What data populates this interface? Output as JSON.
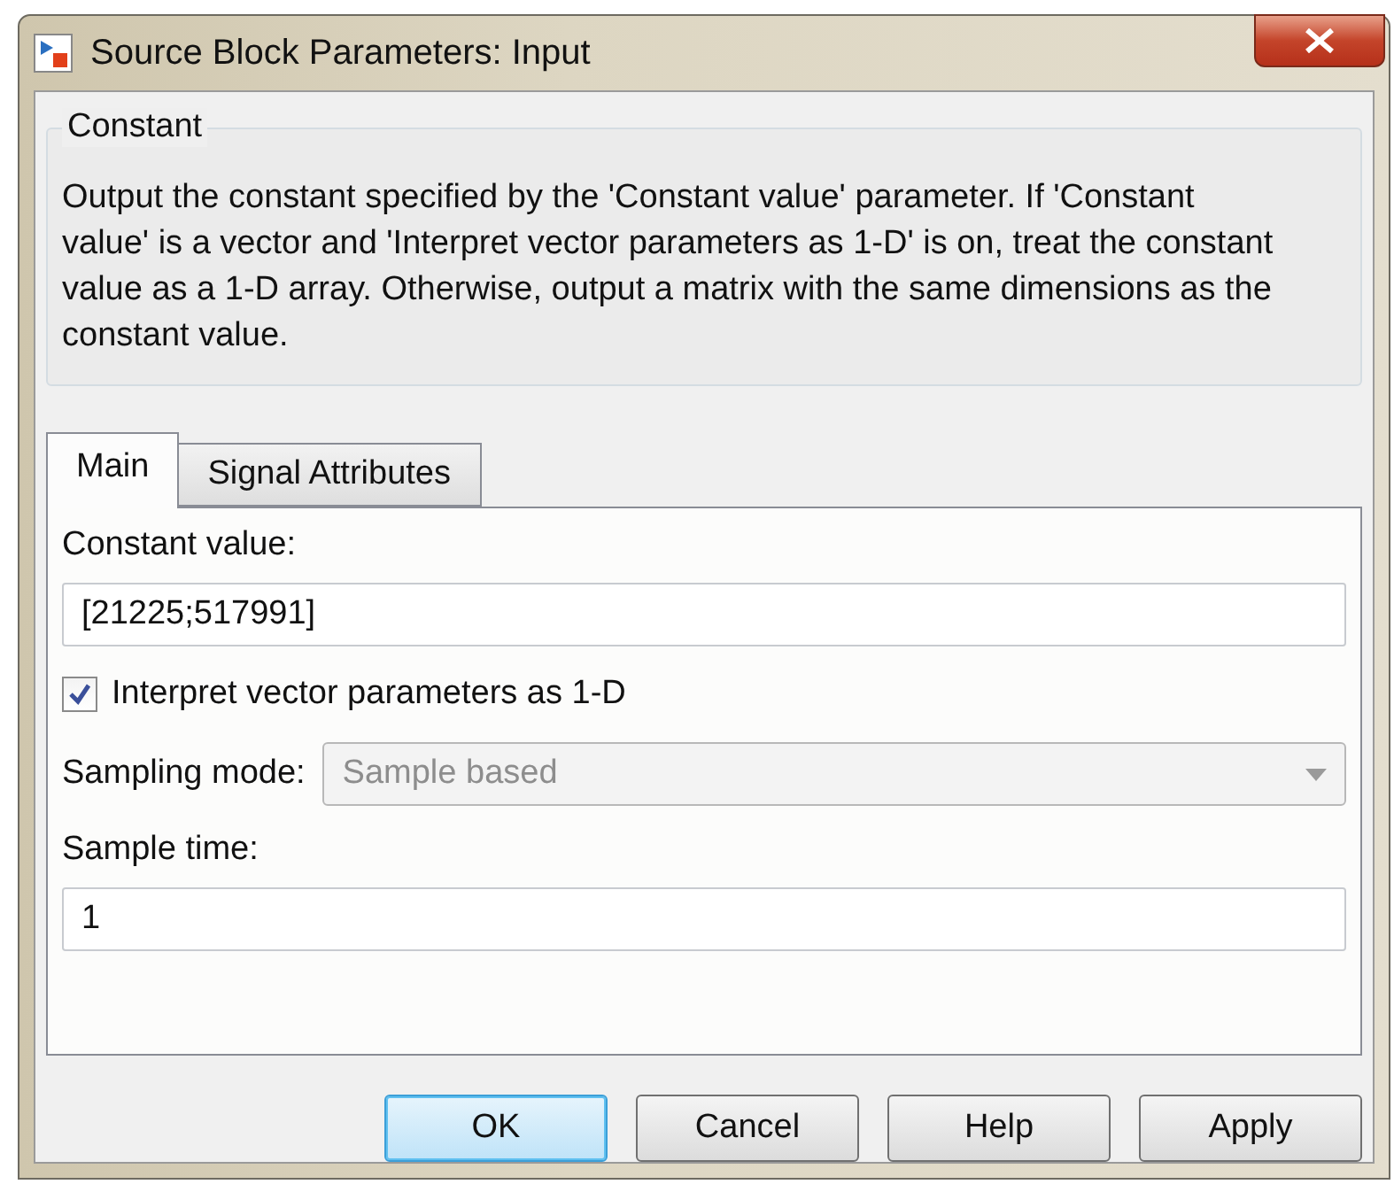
{
  "window": {
    "title": "Source Block Parameters: Input"
  },
  "group": {
    "title": "Constant",
    "description": "Output the constant specified by the 'Constant value' parameter. If 'Constant value' is a vector and 'Interpret vector parameters as 1-D' is on, treat the constant value as a 1-D array. Otherwise, output a matrix with the same dimensions as the constant value."
  },
  "tabs": [
    {
      "label": "Main",
      "selected": true
    },
    {
      "label": "Signal Attributes",
      "selected": false
    }
  ],
  "constant_value": {
    "label": "Constant value:",
    "value": "[21225;517991]"
  },
  "interpret_vector": {
    "label": "Interpret vector parameters as 1-D",
    "checked": true
  },
  "sampling_mode": {
    "label": "Sampling mode:",
    "value": "Sample based",
    "disabled": true
  },
  "sample_time": {
    "label": "Sample time:",
    "value": "1"
  },
  "buttons": [
    {
      "label": "OK",
      "default": true
    },
    {
      "label": "Cancel",
      "default": false
    },
    {
      "label": "Help",
      "default": false
    },
    {
      "label": "Apply",
      "default": false
    }
  ]
}
